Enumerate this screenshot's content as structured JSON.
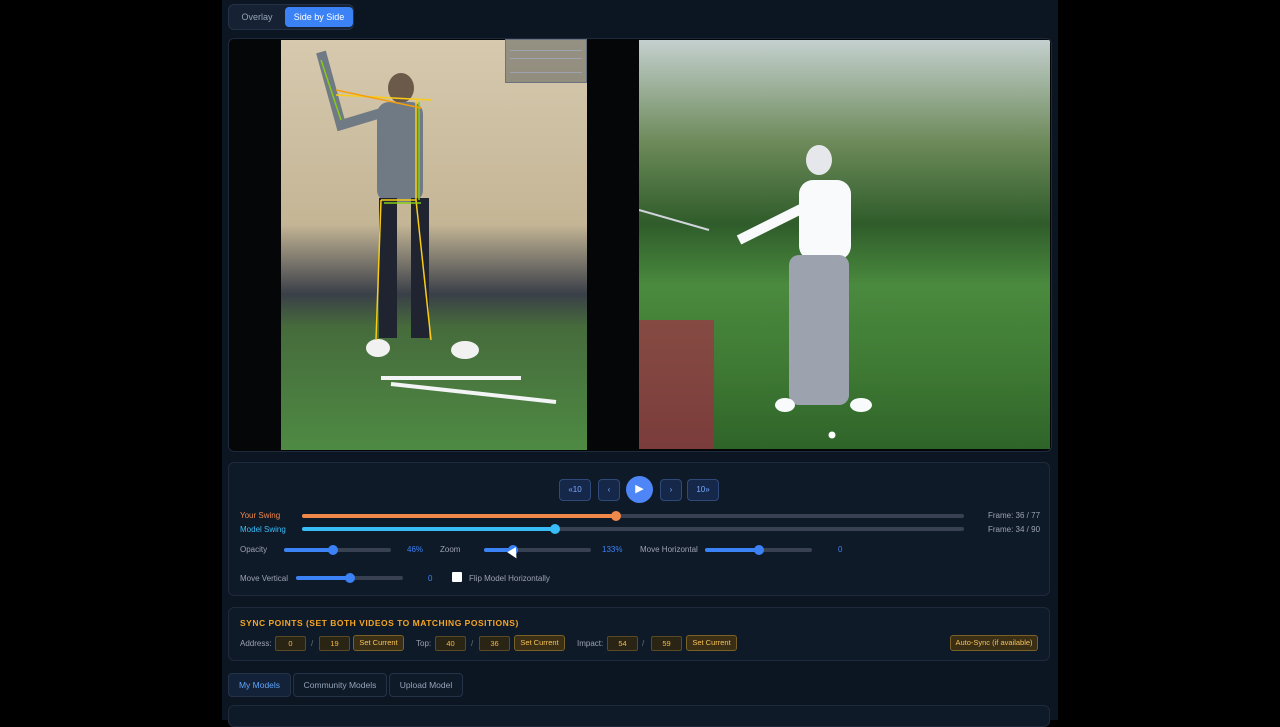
{
  "view_toggle": {
    "overlay": "Overlay",
    "side_by_side": "Side by Side"
  },
  "playback": {
    "back10": "«10",
    "prev": "‹",
    "play": "▶",
    "next": "›",
    "fwd10": "10»"
  },
  "timelines": {
    "your_swing": {
      "label": "Your Swing",
      "frame": "Frame: 36 / 77",
      "progress": 0.4737,
      "color": "#f0884a"
    },
    "model_swing": {
      "label": "Model Swing",
      "frame": "Frame: 34 / 90",
      "progress": 0.382,
      "color": "#38bdf8"
    }
  },
  "adjust": {
    "opacity": {
      "label": "Opacity",
      "value": "46%",
      "level": 0.46
    },
    "zoom": {
      "label": "Zoom",
      "value": "133%",
      "level": 0.27
    },
    "move_horizontal": {
      "label": "Move Horizontal",
      "value": "0",
      "level": 0.5
    },
    "move_vertical": {
      "label": "Move Vertical",
      "value": "0",
      "level": 0.5
    },
    "flip_label": "Flip Model Horizontally"
  },
  "sync": {
    "title": "SYNC POINTS (SET BOTH VIDEOS TO MATCHING POSITIONS)",
    "address": {
      "label": "Address:",
      "a": "0",
      "b": "19"
    },
    "top": {
      "label": "Top:",
      "a": "40",
      "b": "36"
    },
    "impact": {
      "label": "Impact:",
      "a": "54",
      "b": "59"
    },
    "slash": "/",
    "set_current": "Set Current",
    "auto_sync": "Auto-Sync (if available)"
  },
  "tabs": {
    "my_models": "My Models",
    "community_models": "Community Models",
    "upload_model": "Upload Model"
  },
  "colors": {
    "accent": "#3b82f6",
    "your_swing": "#f0884a",
    "model_swing": "#38bdf8",
    "sync_title": "#f5a524"
  }
}
